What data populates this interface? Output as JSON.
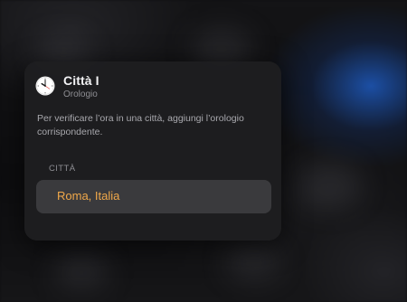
{
  "widget": {
    "title": "Città I",
    "subtitle": "Orologio",
    "icon": "clock-icon",
    "description": "Per verificare l’ora in una città, aggiungi l’orologio corrispondente.",
    "section_header": "CITTÀ",
    "cities": [
      {
        "name": "Roma, Italia"
      }
    ]
  },
  "colors": {
    "accent": "#f0a84a",
    "background": "#0f0f10",
    "card": "#1e1e20",
    "row": "#3a3a3d"
  }
}
